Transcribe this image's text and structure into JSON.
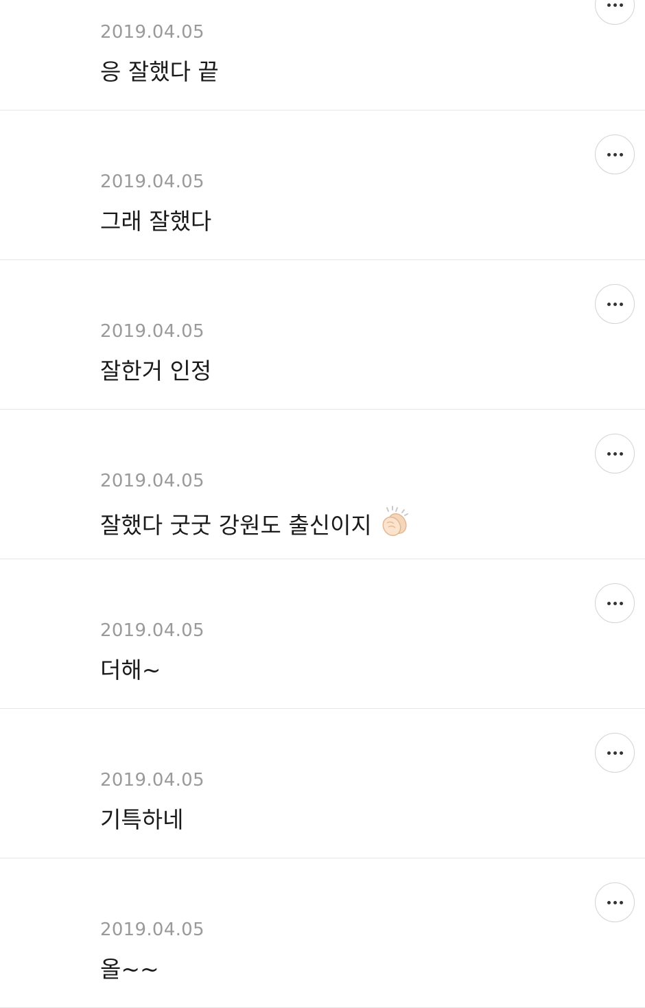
{
  "comments": [
    {
      "date": "2019.04.05",
      "text": "응 잘했다 끝",
      "more_icon": "more-horizontal-icon"
    },
    {
      "date": "2019.04.05",
      "text": "그래 잘했다",
      "more_icon": "more-horizontal-icon"
    },
    {
      "date": "2019.04.05",
      "text": "잘한거 인정",
      "more_icon": "more-horizontal-icon"
    },
    {
      "date": "2019.04.05",
      "text": "잘했다 굿굿 강원도 출신이지",
      "emoji": "clapping-hands-emoji",
      "more_icon": "more-horizontal-icon"
    },
    {
      "date": "2019.04.05",
      "text": "더해~",
      "more_icon": "more-horizontal-icon"
    },
    {
      "date": "2019.04.05",
      "text": "기특하네",
      "more_icon": "more-horizontal-icon"
    },
    {
      "date": "2019.04.05",
      "text": "올~~",
      "more_icon": "more-horizontal-icon"
    }
  ],
  "colors": {
    "date": "#9a9a9a",
    "text": "#1a1a1a",
    "divider": "#e6e6e6",
    "button_border": "#d2d2d2"
  }
}
